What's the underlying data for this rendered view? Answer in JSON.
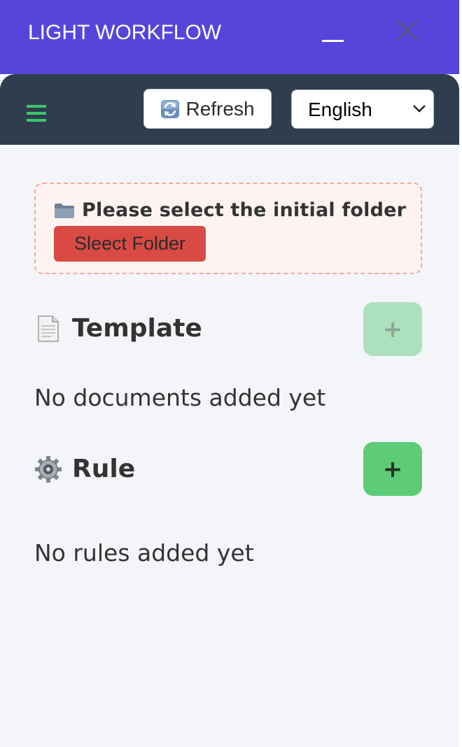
{
  "window": {
    "title": "LIGHT WORKFLOW",
    "minimize_icon": "minimize-icon",
    "close_icon": "close-icon"
  },
  "toolbar": {
    "menu_icon": "hamburger-menu-icon",
    "refresh_label": "Refresh",
    "refresh_icon": "refresh-icon",
    "language": {
      "selected": "English",
      "options": [
        "English"
      ]
    }
  },
  "notice": {
    "icon": "folder-icon",
    "text": "Please select the initial folder",
    "button_label": "Sleect Folder"
  },
  "template_section": {
    "icon": "document-icon",
    "title": "Template",
    "add_label": "+",
    "add_enabled": false,
    "empty_text": "No documents added yet"
  },
  "rule_section": {
    "icon": "gear-icon",
    "title": "Rule",
    "add_label": "+",
    "add_enabled": true,
    "empty_text": "No rules added yet"
  },
  "colors": {
    "title_bar": "#5745db",
    "toolbar": "#2f3d4e",
    "accent_green": "#5ecb78",
    "danger_red": "#d94a45",
    "notice_bg": "#fff3f1",
    "notice_border": "#f2a9a4",
    "page_bg": "#f3f5f9"
  }
}
